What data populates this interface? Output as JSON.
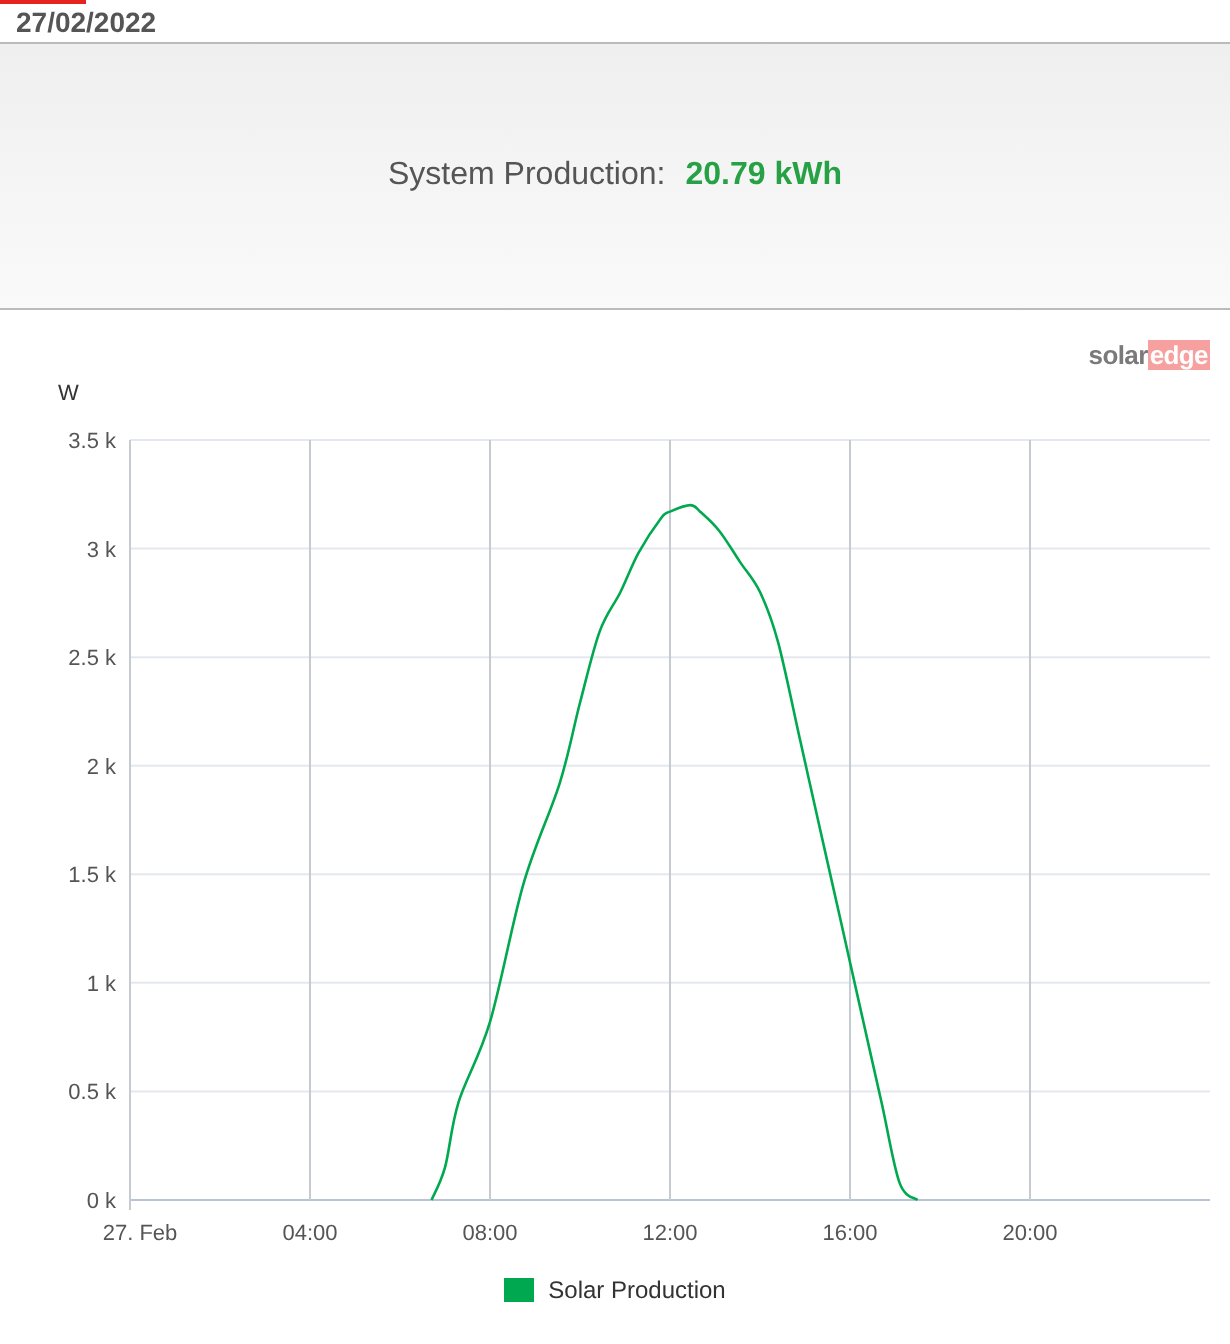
{
  "date": "27/02/2022",
  "summary": {
    "label": "System Production:",
    "value": "20.79 kWh"
  },
  "logo": {
    "first": "solar",
    "second": "edge"
  },
  "chart": {
    "chart_data": {
      "type": "line",
      "ylabel": "W",
      "grid": true,
      "xlim": [
        0,
        24
      ],
      "ylim": [
        0,
        3500
      ],
      "xticks": [
        {
          "value": 0,
          "label": "27. Feb"
        },
        {
          "value": 4,
          "label": "04:00"
        },
        {
          "value": 8,
          "label": "08:00"
        },
        {
          "value": 12,
          "label": "12:00"
        },
        {
          "value": 16,
          "label": "16:00"
        },
        {
          "value": 20,
          "label": "20:00"
        }
      ],
      "yticks": [
        {
          "value": 0,
          "label": "0 k"
        },
        {
          "value": 500,
          "label": "0.5 k"
        },
        {
          "value": 1000,
          "label": "1 k"
        },
        {
          "value": 1500,
          "label": "1.5 k"
        },
        {
          "value": 2000,
          "label": "2 k"
        },
        {
          "value": 2500,
          "label": "2.5 k"
        },
        {
          "value": 3000,
          "label": "3 k"
        },
        {
          "value": 3500,
          "label": "3.5 k"
        }
      ],
      "x": [
        6.7,
        7.0,
        7.3,
        8.0,
        8.75,
        9.55,
        10.0,
        10.44,
        10.9,
        11.3,
        11.8,
        12.0,
        12.45,
        12.67,
        13.1,
        13.55,
        14.0,
        14.4,
        14.9,
        15.3,
        15.8,
        16.2,
        16.7,
        17.1,
        17.5
      ],
      "series": [
        {
          "name": "Solar Production",
          "color": "#00a94f",
          "values": [
            0,
            150,
            450,
            820,
            1460,
            1920,
            2290,
            2620,
            2800,
            2980,
            3140,
            3170,
            3200,
            3170,
            3080,
            2940,
            2800,
            2570,
            2110,
            1740,
            1280,
            910,
            450,
            80,
            0
          ]
        }
      ]
    }
  }
}
